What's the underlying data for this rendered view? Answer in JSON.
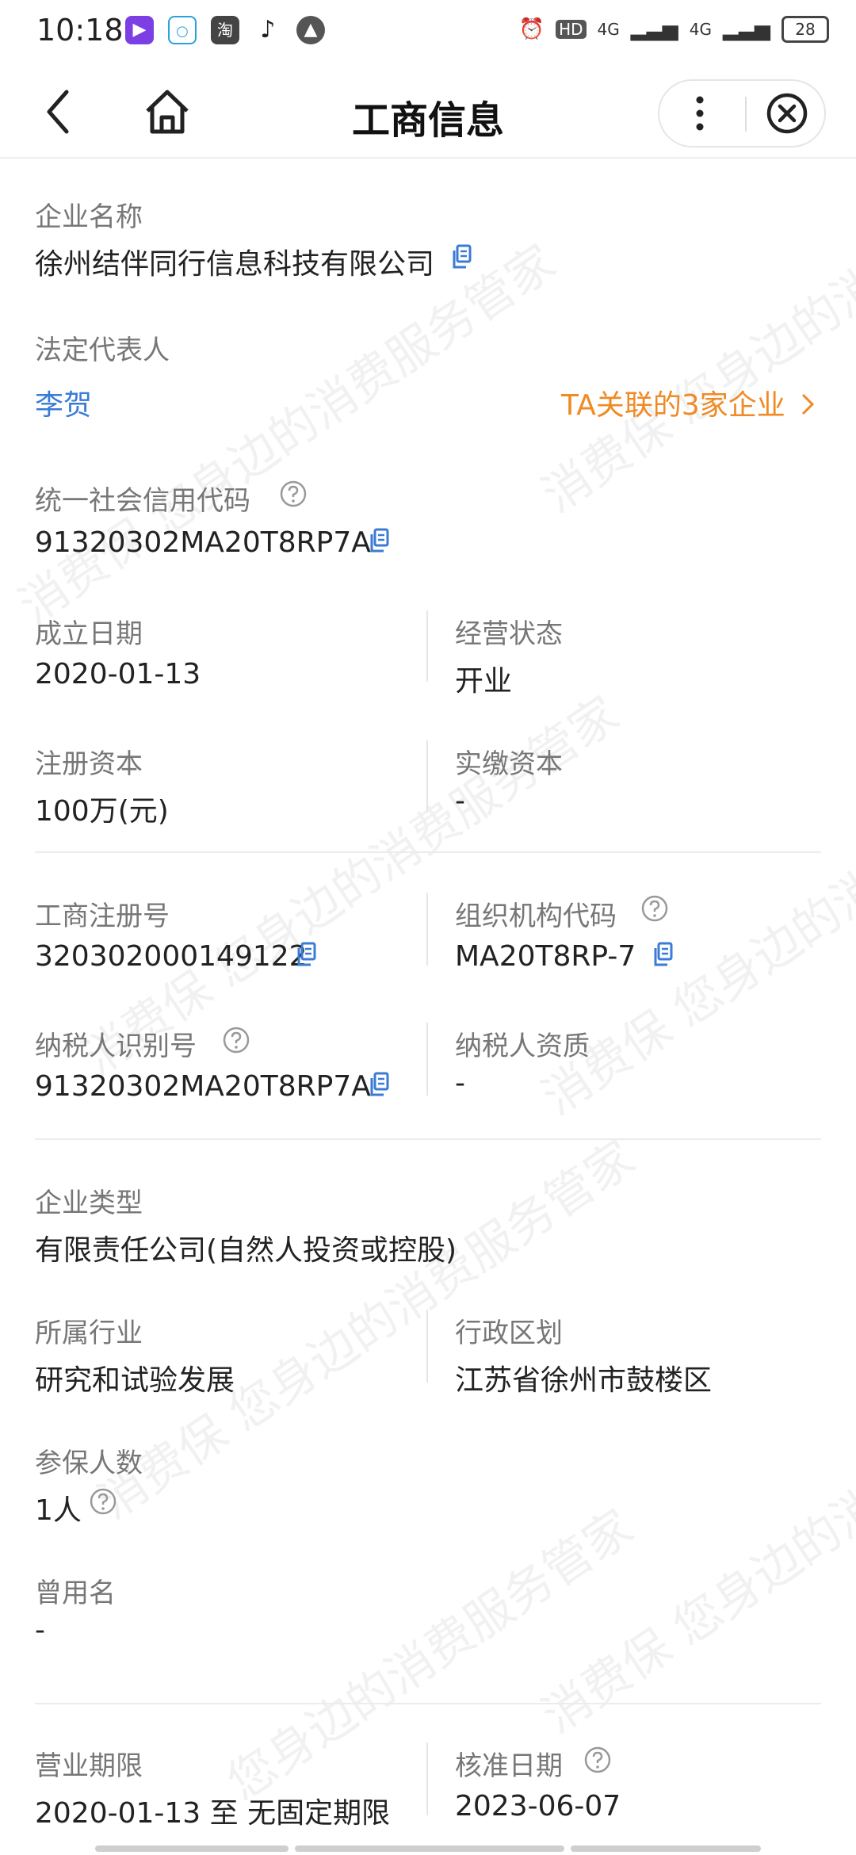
{
  "status_bar": {
    "time": "10:18",
    "app_icon_taobao": "淘",
    "network_1": "4G",
    "network_2": "4G",
    "hd": "HD",
    "battery": "28"
  },
  "nav": {
    "title": "工商信息"
  },
  "company": {
    "name_label": "企业名称",
    "name_value": "徐州结伴同行信息科技有限公司",
    "legal_rep_label": "法定代表人",
    "legal_rep_value": "李贺",
    "related_link": "TA关联的3家企业",
    "uscc_label": "统一社会信用代码",
    "uscc_value": "91320302MA20T8RP7A",
    "founded_label": "成立日期",
    "founded_value": "2020-01-13",
    "status_label": "经营状态",
    "status_value": "开业",
    "reg_capital_label": "注册资本",
    "reg_capital_value": "100万(元)",
    "paid_capital_label": "实缴资本",
    "paid_capital_value": "-",
    "reg_no_label": "工商注册号",
    "reg_no_value": "320302000149122",
    "org_code_label": "组织机构代码",
    "org_code_value": "MA20T8RP-7",
    "taxpayer_id_label": "纳税人识别号",
    "taxpayer_id_value": "91320302MA20T8RP7A",
    "taxpayer_qual_label": "纳税人资质",
    "taxpayer_qual_value": "-",
    "type_label": "企业类型",
    "type_value": "有限责任公司(自然人投资或控股)",
    "industry_label": "所属行业",
    "industry_value": "研究和试验发展",
    "region_label": "行政区划",
    "region_value": "江苏省徐州市鼓楼区",
    "insured_label": "参保人数",
    "insured_value": "1人",
    "former_name_label": "曾用名",
    "former_name_value": "-",
    "term_label": "营业期限",
    "term_value": "2020-01-13 至 无固定期限",
    "approved_label": "核准日期",
    "approved_value": "2023-06-07"
  },
  "watermark": {
    "text_a": "您身边的消费服务管家",
    "text_b": "消费保 您身边的消费服务管家"
  },
  "colors": {
    "link": "#3a7bd5",
    "orange": "#f08a24",
    "label": "#777777"
  }
}
